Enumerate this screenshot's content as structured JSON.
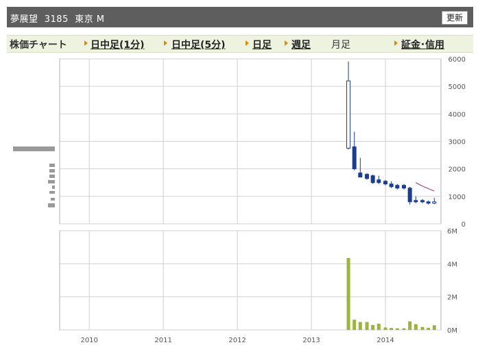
{
  "header": {
    "title": "夢展望  3185  東京 M",
    "refresh_label": "更新"
  },
  "nav": {
    "title": "株価チャート",
    "items": [
      {
        "label": "日中足(1分)",
        "active": true
      },
      {
        "label": "日中足(5分)",
        "active": true
      },
      {
        "label": "日足",
        "active": true
      },
      {
        "label": "週足",
        "active": true
      },
      {
        "label": "月足",
        "active": false
      },
      {
        "label": "証金･信用",
        "active": true
      }
    ]
  },
  "colors": {
    "candle": "#1a3c94",
    "moving_average": "#a0284a",
    "volume": "#9ab43c",
    "grid": "#d0d0d0",
    "nav_arrow": "#e08a00"
  },
  "chart_data": [
    {
      "type": "candlestick",
      "ylim": [
        0,
        6000
      ],
      "yticks": [
        "0",
        "1000",
        "2000",
        "3000",
        "4000",
        "5000",
        "6000"
      ],
      "xlim": [
        2009.6,
        2014.75
      ],
      "xticks": [
        "2010",
        "2011",
        "2012",
        "2013",
        "2014"
      ],
      "candles": [
        {
          "x": 2013.5,
          "open": 2750,
          "high": 5900,
          "low": 2700,
          "close": 5200
        },
        {
          "x": 2013.58,
          "open": 2800,
          "high": 3350,
          "low": 1950,
          "close": 2000
        },
        {
          "x": 2013.66,
          "open": 1850,
          "high": 2400,
          "low": 1700,
          "close": 1700
        },
        {
          "x": 2013.75,
          "open": 1800,
          "high": 1850,
          "low": 1600,
          "close": 1650
        },
        {
          "x": 2013.83,
          "open": 1750,
          "high": 1800,
          "low": 1450,
          "close": 1500
        },
        {
          "x": 2013.91,
          "open": 1600,
          "high": 1750,
          "low": 1450,
          "close": 1500
        },
        {
          "x": 2014.0,
          "open": 1550,
          "high": 1600,
          "low": 1400,
          "close": 1450
        },
        {
          "x": 2014.08,
          "open": 1450,
          "high": 1550,
          "low": 1300,
          "close": 1350
        },
        {
          "x": 2014.16,
          "open": 1400,
          "high": 1450,
          "low": 1250,
          "close": 1300
        },
        {
          "x": 2014.25,
          "open": 1400,
          "high": 1450,
          "low": 1250,
          "close": 1300
        },
        {
          "x": 2014.33,
          "open": 1300,
          "high": 1350,
          "low": 700,
          "close": 800
        },
        {
          "x": 2014.41,
          "open": 850,
          "high": 1000,
          "low": 750,
          "close": 800
        },
        {
          "x": 2014.5,
          "open": 850,
          "high": 900,
          "low": 750,
          "close": 800
        },
        {
          "x": 2014.58,
          "open": 800,
          "high": 850,
          "low": 700,
          "close": 750
        },
        {
          "x": 2014.66,
          "open": 750,
          "high": 950,
          "low": 720,
          "close": 800
        }
      ],
      "moving_average": [
        {
          "x": 2014.41,
          "y": 1500
        },
        {
          "x": 2014.5,
          "y": 1370
        },
        {
          "x": 2014.58,
          "y": 1280
        },
        {
          "x": 2014.66,
          "y": 1190
        }
      ]
    },
    {
      "type": "bar",
      "ylim": [
        0,
        6000000
      ],
      "yticks": [
        "0M",
        "2M",
        "4M",
        "6M"
      ],
      "xticks": [
        "2010",
        "2011",
        "2012",
        "2013",
        "2014"
      ],
      "bars": [
        {
          "x": 2013.5,
          "value": 4350000
        },
        {
          "x": 2013.58,
          "value": 620000
        },
        {
          "x": 2013.66,
          "value": 480000
        },
        {
          "x": 2013.75,
          "value": 480000
        },
        {
          "x": 2013.83,
          "value": 300000
        },
        {
          "x": 2013.91,
          "value": 380000
        },
        {
          "x": 2014.0,
          "value": 150000
        },
        {
          "x": 2014.08,
          "value": 120000
        },
        {
          "x": 2014.16,
          "value": 100000
        },
        {
          "x": 2014.25,
          "value": 100000
        },
        {
          "x": 2014.33,
          "value": 520000
        },
        {
          "x": 2014.41,
          "value": 350000
        },
        {
          "x": 2014.5,
          "value": 180000
        },
        {
          "x": 2014.58,
          "value": 130000
        },
        {
          "x": 2014.66,
          "value": 280000
        }
      ]
    }
  ]
}
